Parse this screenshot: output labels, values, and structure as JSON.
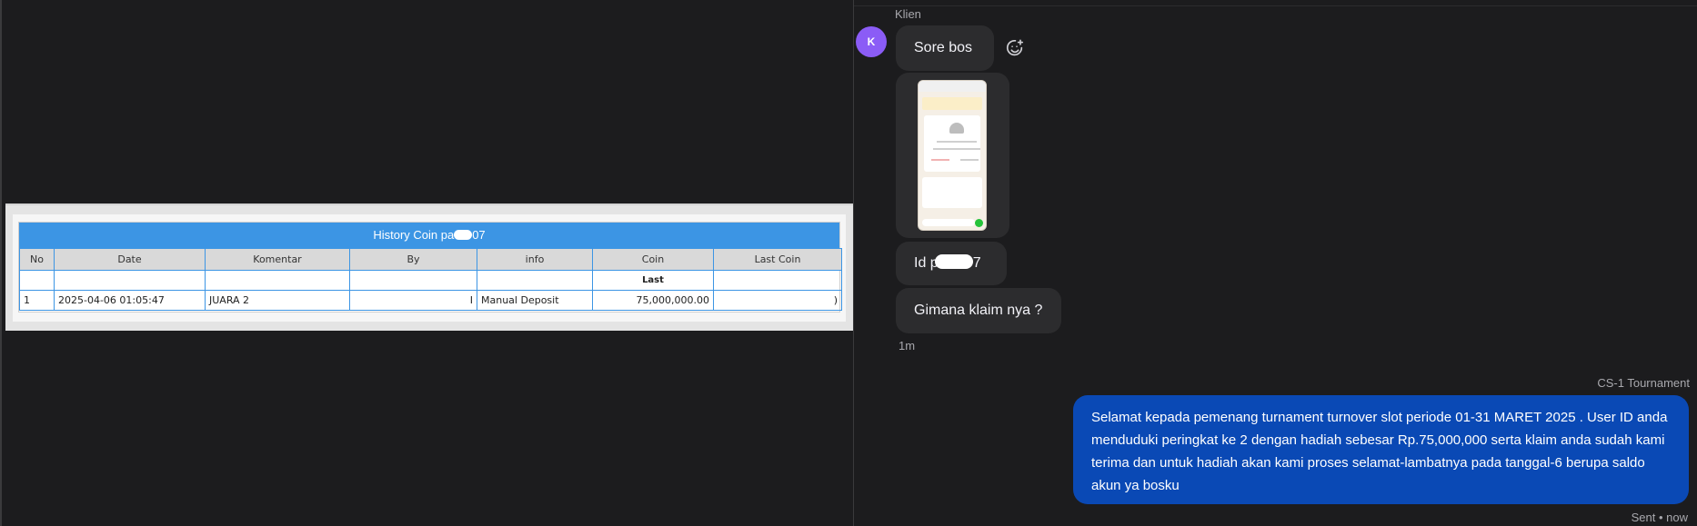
{
  "history_coin": {
    "title_prefix": "History Coin pa",
    "title_suffix": "07",
    "columns": [
      "No",
      "Date",
      "Komentar",
      "By",
      "info",
      "Coin",
      "Last Coin"
    ],
    "subheader": {
      "coin": "Last"
    },
    "rows": [
      {
        "no": "1",
        "date": "2025-04-06 01:05:47",
        "komentar": "JUARA 2",
        "by": "I",
        "info": "Manual Deposit",
        "coin": "75,000,000.00",
        "last_coin": ")"
      }
    ]
  },
  "chat": {
    "sender": "Klien",
    "avatar_initial": "K",
    "messages": [
      {
        "text": "Sore bos"
      },
      {
        "text_prefix": "Id p",
        "text_suffix": "7"
      },
      {
        "text": "Gimana klaim nya ?"
      }
    ],
    "time": "1m",
    "agent": "CS-1 Tournament",
    "reply": "Selamat kepada pemenang turnament turnover slot periode 01-31 MARET 2025 . User ID anda menduduki peringkat ke 2 dengan hadiah sebesar Rp.75,000,000 serta klaim anda sudah kami terima dan untuk hadiah akan kami proses selamat-lambatnya pada tanggal-6 berupa saldo akun ya bosku",
    "status": "Sent • now"
  },
  "colors": {
    "table_header": "#3c95e4",
    "reply_bubble": "#0a49b5",
    "avatar": "#8b5cf6"
  }
}
